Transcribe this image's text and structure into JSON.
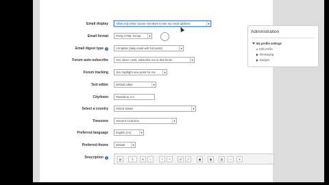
{
  "form": {
    "email_display": {
      "label": "Email display",
      "value": "Allow only other course members to see my email address"
    },
    "email_format": {
      "label": "Email format",
      "value": "Pretty HTML format"
    },
    "email_digest": {
      "label": "Email digest type",
      "value": "Complete (daily email with full posts)"
    },
    "forum_auto": {
      "label": "Forum auto-subscribe",
      "value": "Yes: when I post, subscribe me to that forum"
    },
    "forum_tracking": {
      "label": "Forum tracking",
      "value": "Yes: highlight new posts for me"
    },
    "text_editor": {
      "label": "Text editor",
      "value": "Default editor"
    },
    "city": {
      "label": "City/town",
      "value": "Pasadena, CA"
    },
    "country": {
      "label": "Select a country",
      "value": "United States"
    },
    "timezone": {
      "label": "Timezone",
      "value": "Server's local time"
    },
    "language": {
      "label": "Preferred language",
      "value": "English (en)"
    },
    "theme": {
      "label": "Preferred theme",
      "value": "Default"
    },
    "description": {
      "label": "Description"
    }
  },
  "editor": {
    "buttons": [
      "▤",
      "¶",
      "B",
      "I",
      "≡",
      "≡",
      "🔗",
      "⤢",
      "▣",
      "▦",
      "▥",
      "⌂",
      "✕"
    ]
  },
  "admin": {
    "title": "Administration",
    "my_profile": "My profile settings",
    "items": [
      "Edit profile",
      "Messaging",
      "Badges"
    ]
  },
  "icons": {
    "help": "question-circle-icon",
    "dropdown": "chevron-down-icon",
    "expand": "triangle-down-icon",
    "collapsed": "triangle-right-icon"
  },
  "colors": {
    "accent": "#1d6fb8",
    "background": "#dcdcdc"
  }
}
